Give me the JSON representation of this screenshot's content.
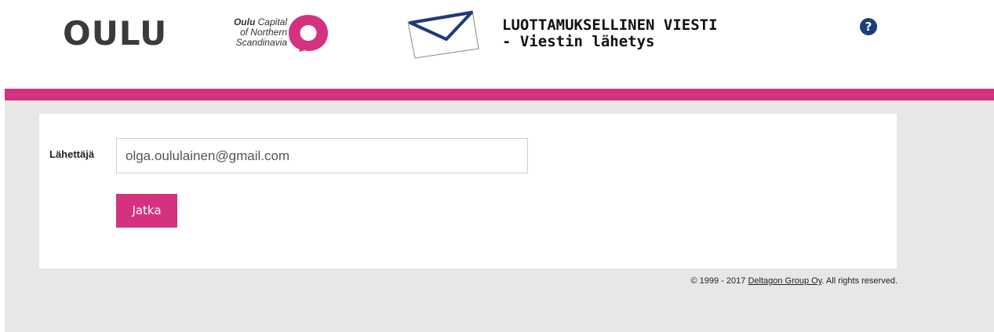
{
  "header": {
    "logo_text": "OULU",
    "tagline": {
      "bold_word": "Oulu",
      "line1_rest": "Capital",
      "line2": "of Northern",
      "line3": "Scandinavia"
    },
    "title_line1": "LUOTTAMUKSELLINEN VIESTI",
    "title_line2": "- Viestin lähetys",
    "help_glyph": "?",
    "brand_color": "#d4327f",
    "envelope_icon": "envelope-icon",
    "help_icon": "help-icon"
  },
  "form": {
    "sender_label": "Lähettäjä",
    "sender_value": "olga.oululainen@gmail.com",
    "continue_label": "Jatka"
  },
  "footer": {
    "copyright_prefix": "© 1999 - 2017 ",
    "company_link": "Deltagon Group Oy",
    "copyright_suffix": ". All rights reserved."
  }
}
